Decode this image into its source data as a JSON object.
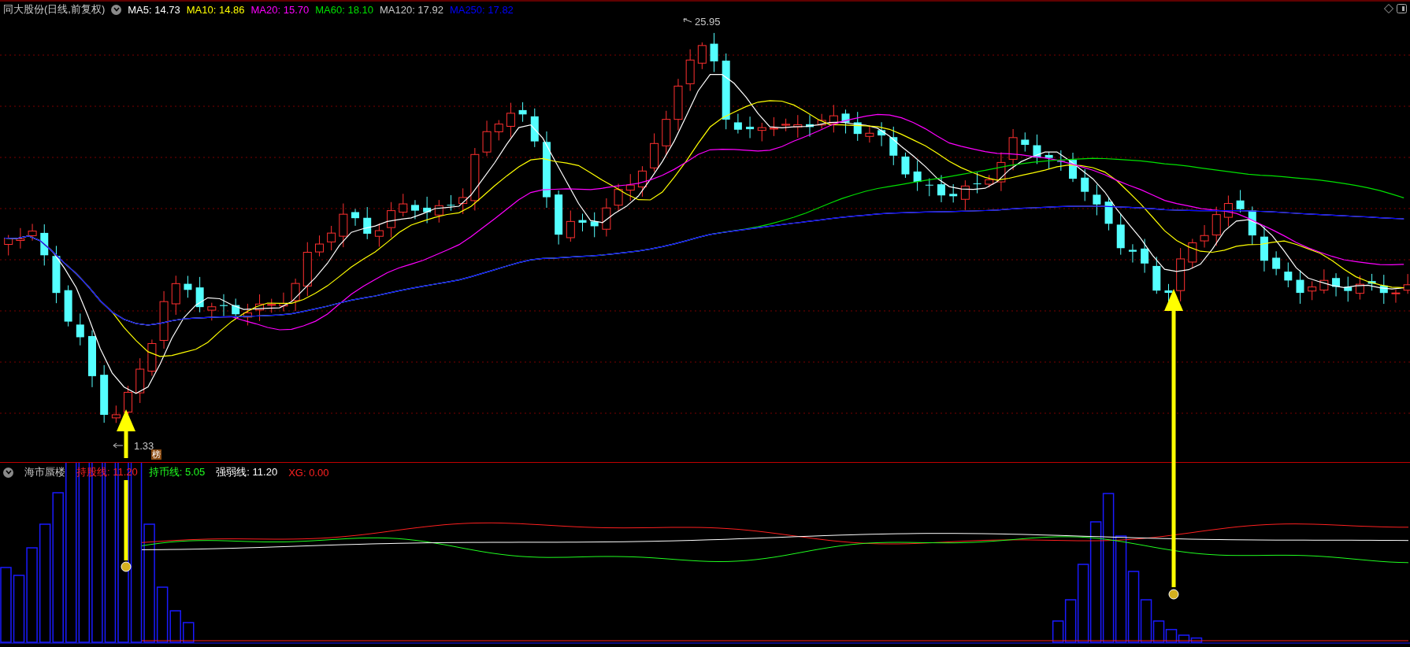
{
  "main_chart": {
    "title": "同大股份(日线,前复权)",
    "moving_averages": [
      {
        "text": "MA5: 14.73",
        "color": "#ffffff"
      },
      {
        "text": "MA10: 14.86",
        "color": "#ffff00"
      },
      {
        "text": "MA20: 15.70",
        "color": "#ff00ff"
      },
      {
        "text": "MA60: 18.10",
        "color": "#00e000"
      },
      {
        "text": "MA120: 17.92",
        "color": "#c8c8c8"
      },
      {
        "text": "MA250: 17.82",
        "color": "#0000ff"
      }
    ],
    "high_label": "25.95",
    "low_label": "1.33",
    "badge": "榜"
  },
  "indicator": {
    "title": "海市蜃楼",
    "lines": [
      {
        "text": "持股线: 11.20",
        "color": "#ff2020"
      },
      {
        "text": "持币线: 5.05",
        "color": "#20ff20"
      },
      {
        "text": "强弱线: 11.20",
        "color": "#ffffff"
      },
      {
        "text": "XG: 0.00",
        "color": "#ff2020"
      }
    ]
  }
}
